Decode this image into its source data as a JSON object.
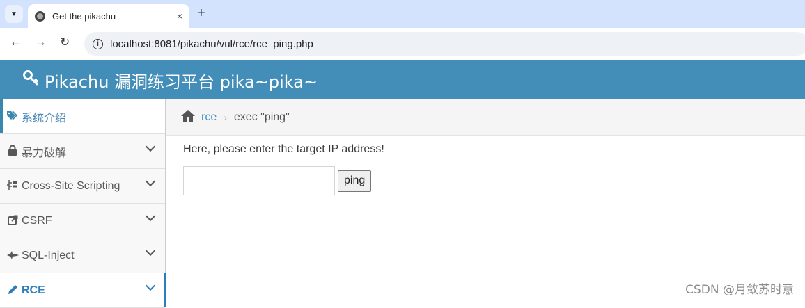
{
  "browser": {
    "tab_menu_icon": "chevron-down-icon",
    "tab_title": "Get the pikachu",
    "tab_close": "×",
    "new_tab": "+",
    "back": "←",
    "forward": "→",
    "reload": "↻",
    "info": "i",
    "url": "localhost:8081/pikachu/vul/rce/rce_ping.php"
  },
  "header": {
    "icon": "key-icon",
    "title": "Pikachu 漏洞练习平台 pika~pika~"
  },
  "sidebar": {
    "items": [
      {
        "label": "系统介绍",
        "icon": "tags-icon",
        "glyph": "🏷"
      },
      {
        "label": "暴力破解",
        "icon": "lock-icon",
        "glyph": "🔒"
      },
      {
        "label": "Cross-Site Scripting",
        "icon": "sitemap-icon",
        "glyph": "⊢"
      },
      {
        "label": "CSRF",
        "icon": "share-icon",
        "glyph": "⇱"
      },
      {
        "label": "SQL-Inject",
        "icon": "fighter-jet-icon",
        "glyph": "✈"
      },
      {
        "label": "RCE",
        "icon": "pencil-icon",
        "glyph": "✎"
      }
    ]
  },
  "breadcrumb": {
    "home_icon": "home-icon",
    "link": "rce",
    "separator": "›",
    "current": "exec \"ping\""
  },
  "main": {
    "prompt": "Here, please enter the target IP address!",
    "input_value": "",
    "button_label": "ping"
  },
  "watermark": "CSDN @月敛苏时意",
  "colors": {
    "header_bg": "#438eb9",
    "accent": "#2b7dbc",
    "tabstrip": "#d3e3fd"
  }
}
